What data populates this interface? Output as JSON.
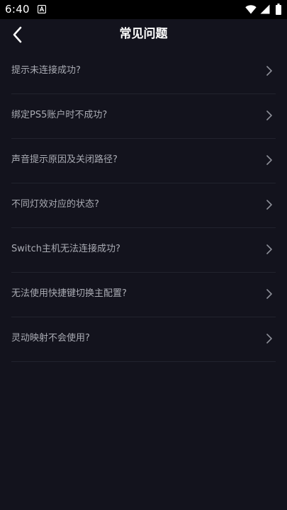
{
  "status_bar": {
    "time": "6:40"
  },
  "header": {
    "title": "常见问题"
  },
  "faq_items": [
    {
      "question": "提示未连接成功?"
    },
    {
      "question": "绑定PS5账户时不成功?"
    },
    {
      "question": "声音提示原因及关闭路径?"
    },
    {
      "question": "不同灯效对应的状态?"
    },
    {
      "question": "Switch主机无法连接成功?"
    },
    {
      "question": "无法使用快捷键切换主配置?"
    },
    {
      "question": "灵动映射不会使用?"
    }
  ],
  "colors": {
    "background": "#13131d",
    "status_bar": "#000000",
    "title": "#ffffff",
    "item_text": "#a9abb3",
    "divider": "#22232e",
    "chevron": "#8e9099"
  }
}
